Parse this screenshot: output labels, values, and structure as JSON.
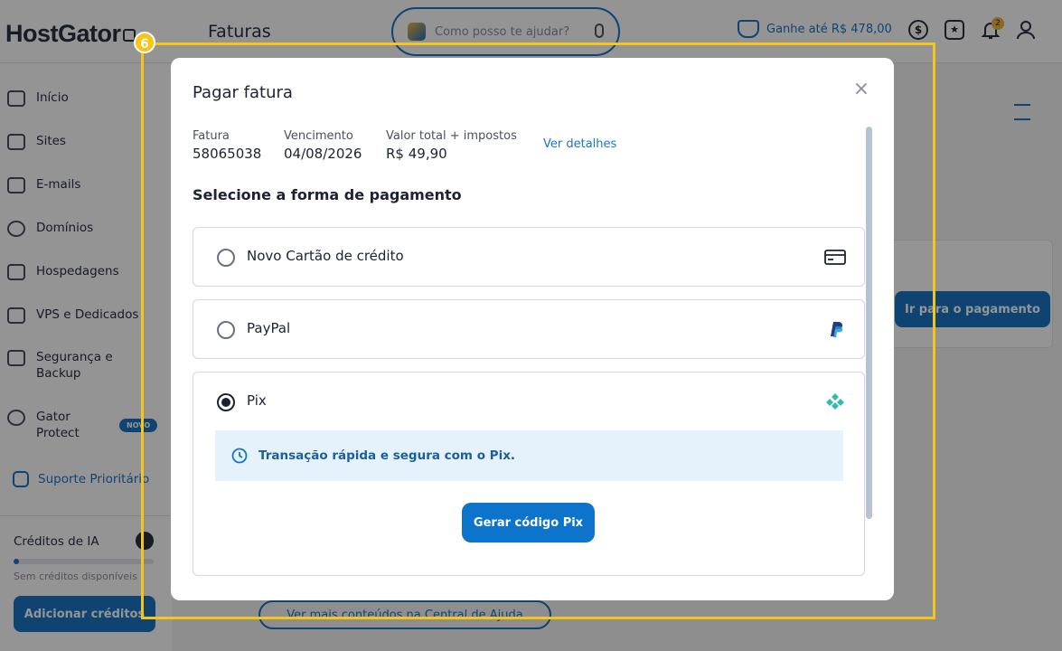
{
  "app": {
    "logo": "HostGator",
    "page_title": "Faturas",
    "assistant_placeholder": "Como posso te ajudar?",
    "earn_text": "Ganhe até R$ 478,00",
    "notification_count": "2",
    "dollar_symbol": "$",
    "chat_symbol": "★"
  },
  "sidebar": {
    "items": [
      {
        "label": "Início"
      },
      {
        "label": "Sites"
      },
      {
        "label": "E-mails"
      },
      {
        "label": "Domínios"
      },
      {
        "label": "Hospedagens"
      },
      {
        "label": "VPS e Dedicados"
      },
      {
        "label": "Segurança e Backup"
      },
      {
        "label": "Gator Protect"
      }
    ],
    "new_badge": "NOVO",
    "support": "Suporte Prioritário",
    "credits": {
      "title": "Créditos de IA",
      "note": "Sem créditos disponíveis",
      "button": "Adicionar créditos",
      "fill_fraction": 0.03
    }
  },
  "background": {
    "go_to_payment": "Ir para o pagamento",
    "help_center": "Ver mais conteúdos na Central de Ajuda"
  },
  "highlight": {
    "step_number": "6",
    "color": "#f5c518"
  },
  "modal": {
    "title": "Pagar fatura",
    "close_symbol": "×",
    "invoice": {
      "label": "Fatura",
      "value": "58065038"
    },
    "due": {
      "label": "Vencimento",
      "value": "04/08/2026"
    },
    "total": {
      "label": "Valor total + impostos",
      "value": "R$ 49,90"
    },
    "details_link": "Ver detalhes",
    "section_title": "Selecione a forma de pagamento",
    "options": [
      {
        "label": "Novo Cartão de crédito",
        "icon": "credit-card-icon",
        "selected": false
      },
      {
        "label": "PayPal",
        "icon": "paypal-icon",
        "selected": false
      },
      {
        "label": "Pix",
        "icon": "pix-icon",
        "selected": true
      }
    ],
    "pix_info": "Transação rápida e segura com o Pix.",
    "pix_button": "Gerar código Pix"
  },
  "colors": {
    "accent": "#0d74cb",
    "pix": "#32bcad",
    "paypal": "#253b80"
  }
}
